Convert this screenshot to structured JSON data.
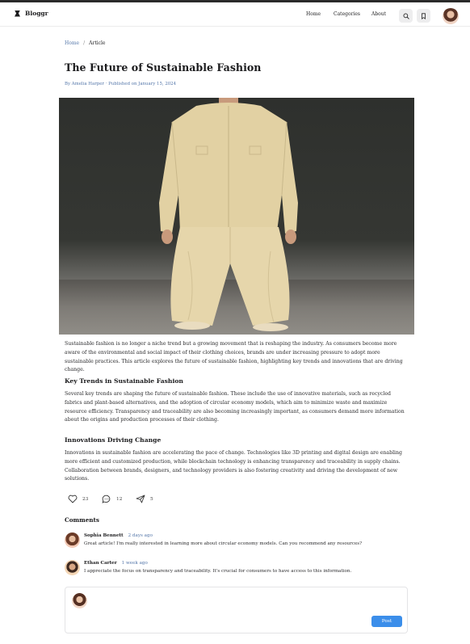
{
  "app": {
    "name": "Bloggr"
  },
  "nav": {
    "home": "Home",
    "categories": "Categories",
    "about": "About"
  },
  "breadcrumb": {
    "home": "Home",
    "separator": "/",
    "current": "Article"
  },
  "article": {
    "title": "The Future of Sustainable Fashion",
    "byline": "By Amelia Harper · Published on January 15, 2024",
    "intro": "Sustainable fashion is no longer a niche trend but a growing movement that is reshaping the industry. As consumers become more aware of the environmental and social impact of their clothing choices, brands are under increasing pressure to adopt more sustainable practices. This article explores the future of sustainable fashion, highlighting key trends and innovations that are driving change.",
    "sections": [
      {
        "heading": "Key Trends in Sustainable Fashion",
        "body": "Several key trends are shaping the future of sustainable fashion. These include the use of innovative materials, such as recycled fabrics and plant-based alternatives, and the adoption of circular economy models, which aim to minimize waste and maximize resource efficiency. Transparency and traceability are also becoming increasingly important, as consumers demand more information about the origins and production processes of their clothing."
      },
      {
        "heading": "Innovations Driving Change",
        "body": "Innovations in sustainable fashion are accelerating the pace of change. Technologies like 3D printing and digital design are enabling more efficient and customized production, while blockchain technology is enhancing transparency and traceability in supply chains. Collaboration between brands, designers, and technology providers is also fostering creativity and driving the development of new solutions."
      }
    ]
  },
  "reactions": {
    "likes": "23",
    "comments": "12",
    "shares": "5"
  },
  "comments": {
    "title": "Comments",
    "items": [
      {
        "name": "Sophia Bennett",
        "time": "2 days ago",
        "text": "Great article! I'm really interested in learning more about circular economy models. Can you recommend any resources?"
      },
      {
        "name": "Ethan Carter",
        "time": "1 week ago",
        "text": "I appreciate the focus on transparency and traceability. It's crucial for consumers to have access to this information."
      }
    ]
  },
  "composer": {
    "placeholder": "",
    "post_label": "Post"
  },
  "colors": {
    "accent": "#3b8eea",
    "link": "#5577aa",
    "garment": "#e3d3a6"
  },
  "icons": {
    "logo": "bowtie-logo-icon",
    "search": "search-icon",
    "bookmark": "bookmark-icon",
    "like": "heart-icon",
    "comment": "comment-bubble-icon",
    "share": "paper-plane-icon"
  }
}
